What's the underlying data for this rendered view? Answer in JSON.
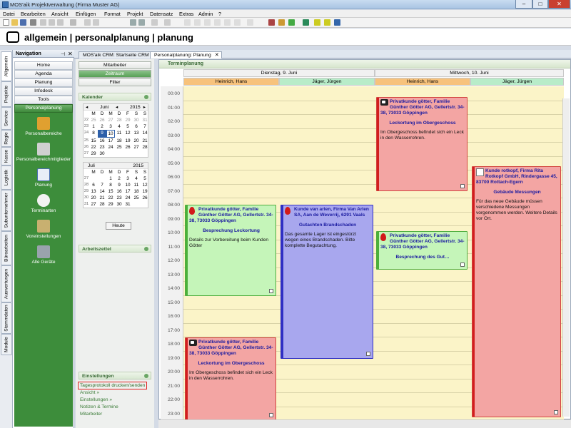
{
  "window": {
    "title": "MOS'aik Projektverwaltung (Firma Muster AG)"
  },
  "menu": [
    "Datei",
    "Bearbeiten",
    "Ansicht",
    "Einfügen",
    "Format",
    "Projekt",
    "Datensatz",
    "Extras",
    "Admin",
    "?"
  ],
  "module_breadcrumb": "allgemein | personalplanung | planung",
  "vertical_tabs": [
    "Allgemein",
    "Projekte",
    "Service",
    "Regie",
    "Kasse",
    "Logistik",
    "Subunternehmer",
    "Büroarbeiten",
    "Auswertungen",
    "Stammdaten",
    "Module"
  ],
  "navigation": {
    "header": "Navigation",
    "buttons": [
      "Home",
      "Agenda",
      "Planung",
      "Infodesk",
      "Tools",
      "Personalplanung"
    ],
    "items": [
      "Personalbereiche",
      "Personalbereichmitglieder",
      "Planung",
      "Terminarten",
      "Voreinstellungen",
      "Alle Geräte"
    ]
  },
  "doc_tabs": [
    "MOS'aik CRM: Startseite CRM",
    "Personalplanung: Planung"
  ],
  "left_col": {
    "buttons": [
      "Mitarbeiter",
      "Zeitraum",
      "Filter"
    ],
    "kalender_header": "Kalender",
    "month1": {
      "name": "Juni",
      "year": "2015"
    },
    "month2": {
      "name": "Juli",
      "year": "2015"
    },
    "weekday_headers": [
      "M",
      "D",
      "M",
      "D",
      "F",
      "S",
      "S"
    ],
    "month1_weeks": [
      {
        "wk": "22",
        "days": [
          "25",
          "26",
          "27",
          "28",
          "29",
          "30",
          "31"
        ]
      },
      {
        "wk": "23",
        "days": [
          "1",
          "2",
          "3",
          "4",
          "5",
          "6",
          "7"
        ]
      },
      {
        "wk": "24",
        "days": [
          "8",
          "9",
          "10",
          "11",
          "12",
          "13",
          "14"
        ]
      },
      {
        "wk": "25",
        "days": [
          "15",
          "16",
          "17",
          "18",
          "19",
          "20",
          "21"
        ]
      },
      {
        "wk": "26",
        "days": [
          "22",
          "23",
          "24",
          "25",
          "26",
          "27",
          "28"
        ]
      },
      {
        "wk": "27",
        "days": [
          "29",
          "30",
          "",
          "",
          "",
          "",
          ""
        ]
      }
    ],
    "month2_weeks": [
      {
        "wk": "27",
        "days": [
          "",
          "",
          "1",
          "2",
          "3",
          "4",
          "5"
        ]
      },
      {
        "wk": "28",
        "days": [
          "6",
          "7",
          "8",
          "9",
          "10",
          "11",
          "12"
        ]
      },
      {
        "wk": "29",
        "days": [
          "13",
          "14",
          "15",
          "16",
          "17",
          "18",
          "19"
        ]
      },
      {
        "wk": "30",
        "days": [
          "20",
          "21",
          "22",
          "23",
          "24",
          "25",
          "26"
        ]
      },
      {
        "wk": "31",
        "days": [
          "27",
          "28",
          "29",
          "30",
          "31",
          "",
          ""
        ]
      }
    ],
    "heute": "Heute",
    "arbeitszettel_header": "Arbeitszettel",
    "einstellungen_header": "Einstellungen",
    "einstellungen_links": [
      "Tagesprotokoll drucken/senden",
      "Ansicht »",
      "Einstellungen »",
      "Notizen & Termine",
      "Mitarbeiter"
    ]
  },
  "schedule": {
    "title": "Terminplanung",
    "days": [
      "Dienstag, 9. Juni",
      "Mittwoch, 10. Juni"
    ],
    "resources": [
      "Heinrich, Hans",
      "Jäger, Jürgen",
      "Heinrich, Hans",
      "Jäger, Jürgen"
    ],
    "times": [
      "00:00",
      "01:00",
      "02:00",
      "03:00",
      "04:00",
      "05:00",
      "06:00",
      "07:00",
      "08:00",
      "09:00",
      "10:00",
      "11:00",
      "12:00",
      "13:00",
      "14:00",
      "15:00",
      "16:00",
      "17:00",
      "18:00",
      "19:00",
      "20:00",
      "21:00",
      "22:00",
      "23:00"
    ],
    "appointments": [
      {
        "lane": 0,
        "color": "green",
        "icon": "drop",
        "head": "Privatkunde götter, Familie Günther Götter AG, Gellertstr. 34-38, 73033 Göppingen",
        "sub": "Besprechung Leckortung",
        "desc": "Details zur Vorbereitung beim Kunden Götter"
      },
      {
        "lane": 1,
        "color": "blue",
        "icon": "drop",
        "head": "Kunde van arlen, Firma Van Arlen SA, Aan de Weverrij, 6291 Vaals",
        "sub": "Gutachten Brandschaden",
        "desc": "Das gesamte Lager ist eingestürzt wegen eines Brandschaden. Bitte komplette Begutachtung."
      },
      {
        "lane": 0,
        "color": "red",
        "icon": "cow",
        "head": "Privatkunde götter, Familie Günther Götter AG, Gellertstr. 34-38, 73033 Göppingen",
        "sub": "Leckortung im Obergeschoss",
        "desc": "Im Obergeschoss befindet sich ein Leck in den Wasserrohren."
      },
      {
        "lane": 2,
        "color": "red",
        "icon": "cow",
        "head": "Privatkunde götter, Familie Günther Götter AG, Gellertstr. 34-38, 73033 Göppingen",
        "sub": "Leckortung im Obergeschoss",
        "desc": "Im Obergeschoss befindet sich ein Leck in den Wasserrohren."
      },
      {
        "lane": 2,
        "color": "green",
        "icon": "drop",
        "head": "Privatkunde götter, Familie Günther Götter AG, Gellertstr. 34-38, 73033 Göppingen",
        "sub": "Besprechung des Gut…",
        "desc": ""
      },
      {
        "lane": 3,
        "color": "red",
        "icon": "cal",
        "head": "Kunde rotkopf, Firma Rita Rotkopf GmbH, Rindergasse 45, 83700 Rottach-Egern",
        "sub": "Gebäude Messungen",
        "desc": "Für das neue Gebäude müssen verschiedene Messungen vorgenommen werden. Weitere Details vor Ort."
      }
    ]
  },
  "colors": {
    "green": "#c5f5b9",
    "green_border": "#4fae3f",
    "blue": "#a8a7ee",
    "blue_border": "#2f2fc4",
    "red": "#f3a5a3",
    "red_border": "#d2453f",
    "accent": "#3d8d3b"
  }
}
